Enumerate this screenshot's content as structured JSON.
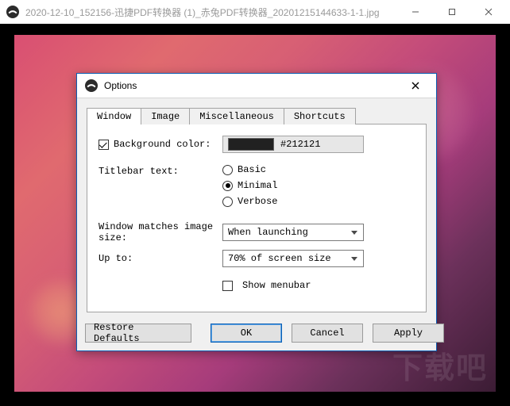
{
  "app": {
    "title": "2020-12-10_152156-迅捷PDF转换器 (1)_赤兔PDF转换器_20201215144633-1-1.jpg",
    "watermark": "下载吧"
  },
  "dialog": {
    "title": "Options",
    "tabs": [
      "Window",
      "Image",
      "Miscellaneous",
      "Shortcuts"
    ],
    "active_tab_index": 0,
    "window_tab": {
      "background_color": {
        "label": "Background color:",
        "checked": true,
        "value_text": "#212121",
        "value_hex": "#212121"
      },
      "titlebar_text": {
        "label": "Titlebar text:",
        "options": [
          "Basic",
          "Minimal",
          "Verbose"
        ],
        "selected_index": 1
      },
      "window_match": {
        "label": "Window matches image size:",
        "value": "When launching"
      },
      "up_to": {
        "label": "Up to:",
        "value": "70% of screen size"
      },
      "show_menubar": {
        "label": "Show menubar",
        "checked": false
      }
    },
    "buttons": {
      "restore": "Restore Defaults",
      "ok": "OK",
      "cancel": "Cancel",
      "apply": "Apply"
    }
  }
}
